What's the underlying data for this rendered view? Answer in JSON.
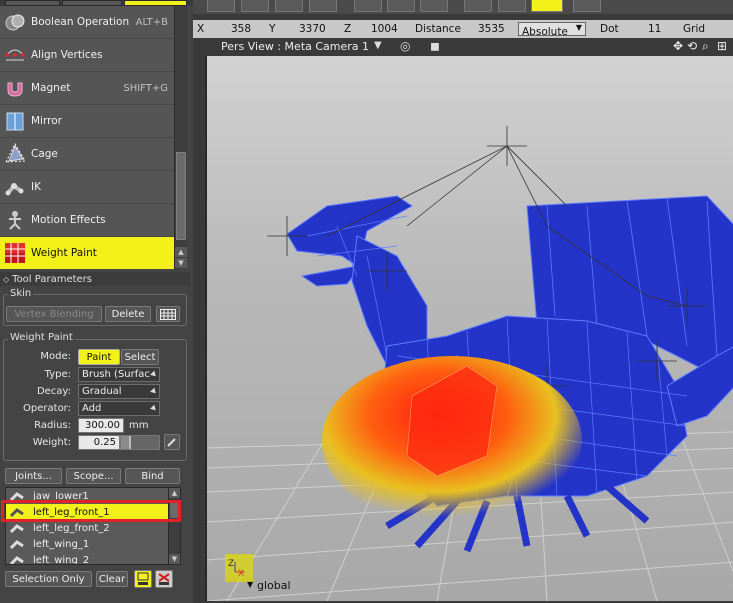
{
  "tools": [
    {
      "label": "Boolean Operation",
      "shortcut": "ALT+B",
      "icon": "boolean-icon"
    },
    {
      "label": "Align Vertices",
      "shortcut": "",
      "icon": "align-vertices-icon"
    },
    {
      "label": "Magnet",
      "shortcut": "SHIFT+G",
      "icon": "magnet-icon"
    },
    {
      "label": "Mirror",
      "shortcut": "",
      "icon": "mirror-icon"
    },
    {
      "label": "Cage",
      "shortcut": "",
      "icon": "cage-icon"
    },
    {
      "label": "IK",
      "shortcut": "",
      "icon": "ik-icon"
    },
    {
      "label": "Motion Effects",
      "shortcut": "",
      "icon": "motion-effects-icon"
    },
    {
      "label": "Weight Paint",
      "shortcut": "",
      "icon": "weight-paint-icon",
      "selected": true
    }
  ],
  "tool_parameters": {
    "title": "Tool Parameters",
    "skin": {
      "title": "Skin",
      "vertex_blending": "Vertex Blending",
      "delete": "Delete"
    },
    "weight_paint": {
      "title": "Weight Paint",
      "mode_label": "Mode:",
      "mode_paint": "Paint",
      "mode_select": "Select",
      "type_label": "Type:",
      "type_value": "Brush (Surfac",
      "decay_label": "Decay:",
      "decay_value": "Gradual",
      "operator_label": "Operator:",
      "operator_value": "Add",
      "radius_label": "Radius:",
      "radius_value": "300.00",
      "radius_unit": "mm",
      "weight_label": "Weight:",
      "weight_value": "0.25",
      "weight_fraction": 0.25
    },
    "joints_btn": "Joints...",
    "scope_btn": "Scope...",
    "bind_btn": "Bind",
    "joints": [
      {
        "name": "jaw_lower1"
      },
      {
        "name": "left_leg_front_1",
        "selected": true
      },
      {
        "name": "left_leg_front_2"
      },
      {
        "name": "left_wing_1"
      },
      {
        "name": "left_wing_2"
      }
    ],
    "selection_only": "Selection Only",
    "clear": "Clear"
  },
  "coords": {
    "x_label": "X",
    "x": "358",
    "y_label": "Y",
    "y": "3370",
    "z_label": "Z",
    "z": "1004",
    "distance_label": "Distance",
    "distance": "3535",
    "mode": "Absolute",
    "dot_label": "Dot",
    "dot": "11",
    "grid_label": "Grid"
  },
  "viewport": {
    "title": "Pers View : Meta Camera 1",
    "coord_space": "global"
  },
  "colors": {
    "selection": "#f2f21a",
    "highlight": "#e1222a",
    "mesh": "#2433c8",
    "wire": "#4a6cff"
  }
}
